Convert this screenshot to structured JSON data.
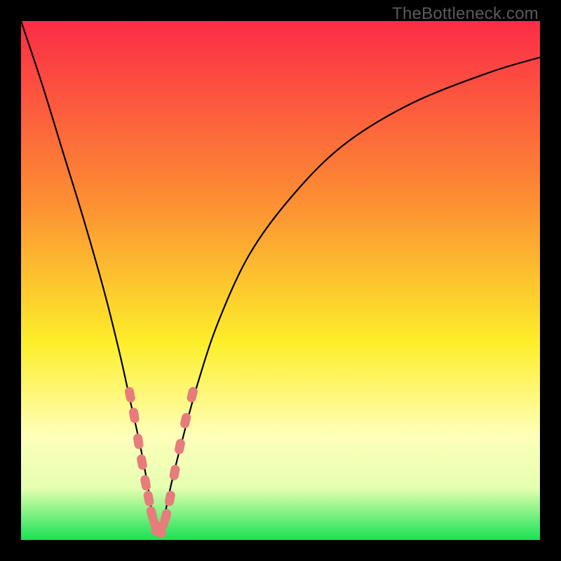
{
  "watermark": "TheBottleneck.com",
  "colors": {
    "bg_top": "#fb2c47",
    "bg_mid1": "#fd8f33",
    "bg_mid2": "#fdee2a",
    "bg_low1": "#feffba",
    "bg_low2": "#e5ffb0",
    "bg_bottom": "#18e254",
    "frame": "#000000",
    "curve": "#000000",
    "marker": "#e77c7c"
  },
  "chart_data": {
    "type": "line",
    "title": "",
    "xlabel": "",
    "ylabel": "",
    "xlim": [
      0,
      100
    ],
    "ylim": [
      0,
      100
    ],
    "notch_x": 26.5,
    "series": [
      {
        "name": "bottleneck-curve",
        "x": [
          0,
          4,
          8,
          12,
          16,
          19,
          21,
          23,
          24.5,
          25.5,
          26.5,
          27.5,
          29,
          31,
          34,
          38,
          44,
          52,
          62,
          75,
          90,
          100
        ],
        "y": [
          100,
          88,
          75,
          62,
          48,
          36,
          27,
          18,
          10,
          4,
          1,
          4,
          11,
          19,
          30,
          42,
          55,
          66,
          76,
          84,
          90,
          93
        ]
      }
    ],
    "markers": {
      "name": "highlighted-points",
      "points": [
        {
          "x": 21.0,
          "y": 28
        },
        {
          "x": 21.8,
          "y": 24
        },
        {
          "x": 22.6,
          "y": 19
        },
        {
          "x": 23.3,
          "y": 15
        },
        {
          "x": 24.0,
          "y": 11
        },
        {
          "x": 24.6,
          "y": 8
        },
        {
          "x": 25.2,
          "y": 5
        },
        {
          "x": 25.8,
          "y": 3
        },
        {
          "x": 26.5,
          "y": 1.5
        },
        {
          "x": 27.2,
          "y": 2.5
        },
        {
          "x": 27.9,
          "y": 4.5
        },
        {
          "x": 28.7,
          "y": 8
        },
        {
          "x": 29.6,
          "y": 13
        },
        {
          "x": 30.6,
          "y": 18
        },
        {
          "x": 31.7,
          "y": 23
        },
        {
          "x": 33.0,
          "y": 28
        }
      ]
    }
  }
}
